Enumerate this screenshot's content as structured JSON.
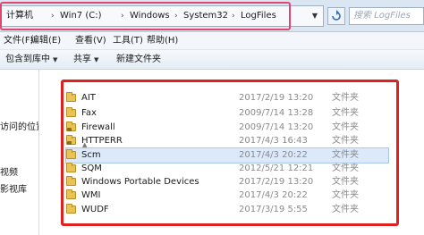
{
  "address_bar": {
    "crumbs": [
      "计算机",
      "Win7 (C:)",
      "Windows",
      "System32",
      "LogFiles"
    ],
    "search_placeholder": "搜索 LogFiles"
  },
  "menu": [
    "文件(F)",
    "编辑(E)",
    "查看(V)",
    "工具(T)",
    "帮助(H)"
  ],
  "toolbar": {
    "include_label": "包含到库中",
    "share_label": "共享",
    "new_folder_label": "新建文件夹"
  },
  "nav": {
    "items": [
      "访问的位置",
      "视频",
      "影视库"
    ]
  },
  "files": [
    {
      "name": "AIT",
      "date": "2017/2/19 13:20",
      "type": "文件夹",
      "locked": false
    },
    {
      "name": "Fax",
      "date": "2009/7/14 13:28",
      "type": "文件夹",
      "locked": false
    },
    {
      "name": "Firewall",
      "date": "2009/7/14 13:20",
      "type": "文件夹",
      "locked": true
    },
    {
      "name": "HTTPERR",
      "date": "2017/4/3 16:43",
      "type": "文件夹",
      "locked": true
    },
    {
      "name": "Scm",
      "date": "2017/4/3 20:22",
      "type": "文件夹",
      "locked": false
    },
    {
      "name": "SQM",
      "date": "2012/5/21 12:21",
      "type": "文件夹",
      "locked": false
    },
    {
      "name": "Windows Portable Devices",
      "date": "2017/2/19 13:20",
      "type": "文件夹",
      "locked": false
    },
    {
      "name": "WMI",
      "date": "2017/4/3 20:22",
      "type": "文件夹",
      "locked": false
    },
    {
      "name": "WUDF",
      "date": "2017/3/19 5:55",
      "type": "文件夹",
      "locked": false
    }
  ],
  "selected_index": 4,
  "colors": {
    "address_highlight": "#e0466f",
    "list_highlight": "#e0201e",
    "folder": "#e8c35a"
  }
}
